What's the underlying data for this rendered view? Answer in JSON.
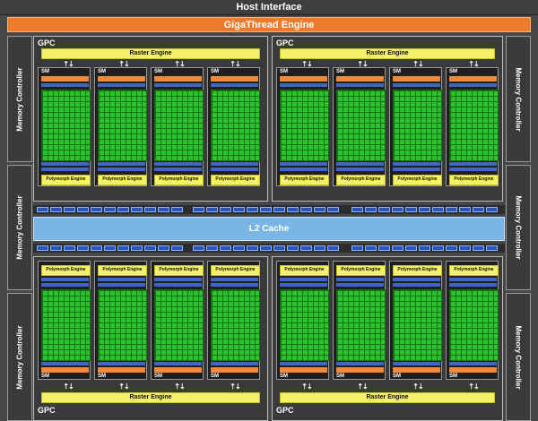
{
  "chip": {
    "host_interface": "Host Interface",
    "gigathread_engine": "GigaThread Engine",
    "l2_cache": "L2 Cache",
    "memory_controller": "Memory Controller",
    "gpc_label": "GPC",
    "raster_engine": "Raster Engine",
    "polymorph_engine": "Polymorph Engine",
    "sm_label": "SM"
  },
  "colors": {
    "background": "#474747",
    "gigathread": "#ee7a2c",
    "raster": "#f4f06a",
    "l2_cache": "#79b6e6",
    "core_grid": "#2cc22c",
    "register_bar": "#3f66c5",
    "orange_bar": "#f08a3a"
  },
  "structure": {
    "gpc_count": 4,
    "sm_per_gpc": 4,
    "memory_controllers_per_side": 3
  }
}
